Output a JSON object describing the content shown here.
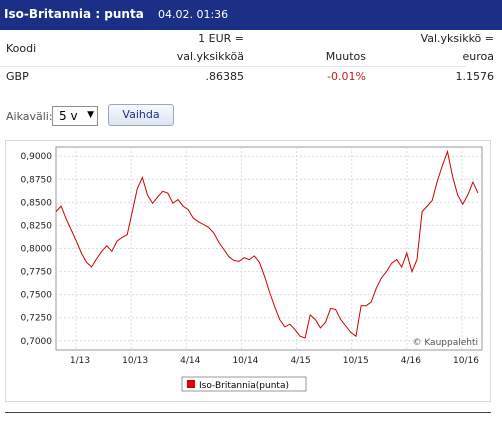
{
  "header": {
    "title": "Iso-Britannia : punta",
    "date": "04.02. 01:36"
  },
  "table": {
    "col_code": "Koodi",
    "col_rate_1": "1 EUR =",
    "col_rate_2": "val.yksikköä",
    "col_change": "Muutos",
    "col_inv_1": "Val.yksikkö =",
    "col_inv_2": "euroa",
    "row": {
      "code": "GBP",
      "rate": ".86385",
      "change": "-0.01%",
      "inv": "1.1576"
    }
  },
  "controls": {
    "interval_label": "Aikaväli:",
    "interval_value": "5 v",
    "change_button": "Vaihda"
  },
  "chart_data": {
    "type": "line",
    "x_labels": [
      "1/13",
      "10/13",
      "4/14",
      "10/14",
      "4/15",
      "10/15",
      "4/16",
      "10/16"
    ],
    "y_labels": [
      "0,9000",
      "0,8750",
      "0,8500",
      "0,8250",
      "0,8000",
      "0,7750",
      "0,7500",
      "0,7250",
      "0,7000"
    ],
    "ylim": [
      0.69,
      0.91
    ],
    "credit": "© Kauppalehti",
    "legend": "Iso-Britannia(punta)",
    "line_color": "#cc0000",
    "series": [
      {
        "x": 0,
        "y": 0.84
      },
      {
        "x": 0.02,
        "y": 0.846
      },
      {
        "x": 0.04,
        "y": 0.832
      },
      {
        "x": 0.06,
        "y": 0.82
      },
      {
        "x": 0.08,
        "y": 0.808
      },
      {
        "x": 0.1,
        "y": 0.795
      },
      {
        "x": 0.12,
        "y": 0.785
      },
      {
        "x": 0.14,
        "y": 0.78
      },
      {
        "x": 0.16,
        "y": 0.789
      },
      {
        "x": 0.18,
        "y": 0.797
      },
      {
        "x": 0.2,
        "y": 0.803
      },
      {
        "x": 0.22,
        "y": 0.797
      },
      {
        "x": 0.24,
        "y": 0.808
      },
      {
        "x": 0.26,
        "y": 0.812
      },
      {
        "x": 0.28,
        "y": 0.815
      },
      {
        "x": 0.3,
        "y": 0.84
      },
      {
        "x": 0.32,
        "y": 0.865
      },
      {
        "x": 0.34,
        "y": 0.877
      },
      {
        "x": 0.36,
        "y": 0.858
      },
      {
        "x": 0.38,
        "y": 0.849
      },
      {
        "x": 0.4,
        "y": 0.856
      },
      {
        "x": 0.42,
        "y": 0.862
      },
      {
        "x": 0.44,
        "y": 0.86
      },
      {
        "x": 0.46,
        "y": 0.849
      },
      {
        "x": 0.48,
        "y": 0.853
      },
      {
        "x": 0.5,
        "y": 0.846
      },
      {
        "x": 0.52,
        "y": 0.842
      },
      {
        "x": 0.54,
        "y": 0.833
      },
      {
        "x": 0.56,
        "y": 0.829
      },
      {
        "x": 0.58,
        "y": 0.826
      },
      {
        "x": 0.6,
        "y": 0.823
      },
      {
        "x": 0.62,
        "y": 0.817
      },
      {
        "x": 0.64,
        "y": 0.807
      },
      {
        "x": 0.66,
        "y": 0.799
      },
      {
        "x": 0.68,
        "y": 0.791
      },
      {
        "x": 0.7,
        "y": 0.787
      },
      {
        "x": 0.72,
        "y": 0.786
      },
      {
        "x": 0.74,
        "y": 0.79
      },
      {
        "x": 0.76,
        "y": 0.788
      },
      {
        "x": 0.78,
        "y": 0.792
      },
      {
        "x": 0.8,
        "y": 0.785
      },
      {
        "x": 0.82,
        "y": 0.77
      },
      {
        "x": 0.84,
        "y": 0.753
      },
      {
        "x": 0.86,
        "y": 0.737
      },
      {
        "x": 0.88,
        "y": 0.723
      },
      {
        "x": 0.9,
        "y": 0.715
      },
      {
        "x": 0.92,
        "y": 0.718
      },
      {
        "x": 0.94,
        "y": 0.712
      },
      {
        "x": 0.96,
        "y": 0.705
      },
      {
        "x": 0.98,
        "y": 0.703
      },
      {
        "x": 1.0,
        "y": 0.728
      },
      {
        "x": 1.02,
        "y": 0.723
      },
      {
        "x": 1.04,
        "y": 0.714
      },
      {
        "x": 1.06,
        "y": 0.72
      },
      {
        "x": 1.08,
        "y": 0.735
      },
      {
        "x": 1.1,
        "y": 0.734
      },
      {
        "x": 1.12,
        "y": 0.723
      },
      {
        "x": 1.14,
        "y": 0.716
      },
      {
        "x": 1.16,
        "y": 0.709
      },
      {
        "x": 1.18,
        "y": 0.705
      },
      {
        "x": 1.2,
        "y": 0.738
      },
      {
        "x": 1.22,
        "y": 0.738
      },
      {
        "x": 1.24,
        "y": 0.742
      },
      {
        "x": 1.26,
        "y": 0.757
      },
      {
        "x": 1.28,
        "y": 0.768
      },
      {
        "x": 1.3,
        "y": 0.775
      },
      {
        "x": 1.32,
        "y": 0.784
      },
      {
        "x": 1.34,
        "y": 0.788
      },
      {
        "x": 1.36,
        "y": 0.78
      },
      {
        "x": 1.38,
        "y": 0.795
      },
      {
        "x": 1.4,
        "y": 0.775
      },
      {
        "x": 1.42,
        "y": 0.788
      },
      {
        "x": 1.44,
        "y": 0.84
      },
      {
        "x": 1.46,
        "y": 0.846
      },
      {
        "x": 1.48,
        "y": 0.852
      },
      {
        "x": 1.5,
        "y": 0.873
      },
      {
        "x": 1.52,
        "y": 0.89
      },
      {
        "x": 1.54,
        "y": 0.905
      },
      {
        "x": 1.56,
        "y": 0.878
      },
      {
        "x": 1.58,
        "y": 0.858
      },
      {
        "x": 1.6,
        "y": 0.848
      },
      {
        "x": 1.62,
        "y": 0.858
      },
      {
        "x": 1.64,
        "y": 0.872
      },
      {
        "x": 1.66,
        "y": 0.86
      }
    ]
  }
}
